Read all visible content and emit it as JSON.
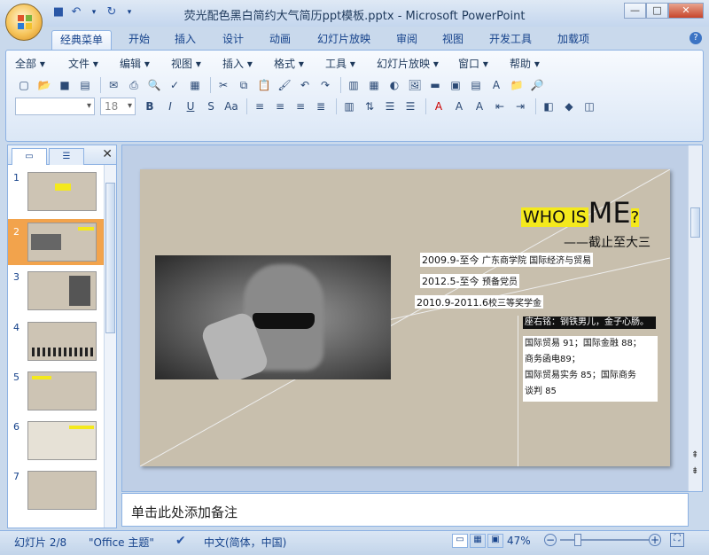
{
  "window": {
    "title": "荧光配色黑白简约大气简历ppt模板.pptx - Microsoft PowerPoint"
  },
  "tabs": [
    "经典菜单",
    "开始",
    "插入",
    "设计",
    "动画",
    "幻灯片放映",
    "审阅",
    "视图",
    "开发工具",
    "加载项"
  ],
  "menu": [
    "全部",
    "文件",
    "编辑",
    "视图",
    "插入",
    "格式",
    "工具",
    "幻灯片放映",
    "窗口",
    "帮助"
  ],
  "font_size": "18",
  "thumbnails": [
    "1",
    "2",
    "3",
    "4",
    "5",
    "6",
    "7"
  ],
  "slide": {
    "who": "WHO IS",
    "me": "ME",
    "q": "?",
    "subtitle": "——截止至大三",
    "lines": [
      {
        "date": "2009.9-至今",
        "text": "广东商学院    国际经济与贸易"
      },
      {
        "date": "2012.5-至今",
        "text": "预备党员"
      },
      {
        "date": "2010.9-2011.6",
        "text": "校三等奖学金"
      }
    ],
    "motto": "座右铭：钢铁男儿，金子心肠。",
    "grades": [
      "国际贸易 91；国际金融 88；",
      "商务函电89；",
      "国际贸易实务 85；国际商务",
      "谈判 85"
    ]
  },
  "notes_placeholder": "单击此处添加备注",
  "status": {
    "slide": "幻灯片 2/8",
    "theme": "\"Office 主题\"",
    "lang": "中文(简体，中国)",
    "zoom": "47%"
  },
  "colors": {
    "highlight": "#f4e91c",
    "accent_selection": "#f2a34c"
  }
}
